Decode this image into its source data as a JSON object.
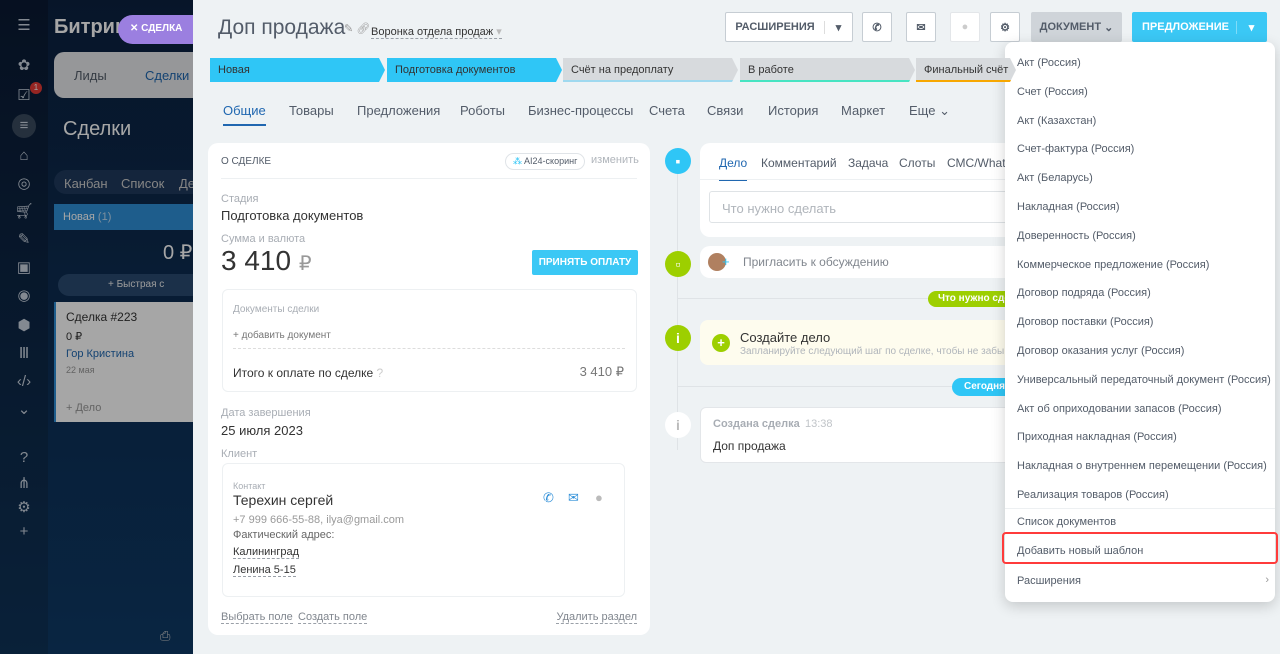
{
  "app": {
    "brand": "Битрикс",
    "slider_tag": "СДЕЛКА",
    "badge_count": "1"
  },
  "bg": {
    "tabs": [
      "Лиды",
      "Сделки"
    ],
    "title": "Сделки",
    "views": [
      "Канбан",
      "Список",
      "Де"
    ],
    "column": "Новая",
    "column_count": "(1)",
    "column_sum": "0 ₽",
    "quick": "+ Быстрая с",
    "deal": {
      "title": "Сделка #223",
      "sum": "0 ₽",
      "person": "Гор Кристина",
      "date": "22 мая",
      "add": "+ Дело"
    }
  },
  "header": {
    "title": "Доп продажа",
    "pipeline": "Воронка отдела продаж",
    "extensions": "РАСШИРЕНИЯ",
    "document": "ДОКУМЕНТ",
    "proposal": "ПРЕДЛОЖЕНИЕ"
  },
  "stages": [
    {
      "label": "Новая",
      "color": "#2fc6f6"
    },
    {
      "label": "Подготовка документов",
      "color": "#2fc6f6"
    },
    {
      "label": "Счёт на предоплату",
      "color": "#d7dadd"
    },
    {
      "label": "В работе",
      "color": "#d7dadd"
    },
    {
      "label": "Финальный счёт",
      "color": "#d7dadd"
    }
  ],
  "tabs": [
    "Общие",
    "Товары",
    "Предложения",
    "Роботы",
    "Бизнес-процессы",
    "Счета",
    "Связи",
    "История",
    "Маркет",
    "Еще"
  ],
  "deal": {
    "section": "О СДЕЛКЕ",
    "scoring": "AI24-скоринг",
    "edit": "изменить",
    "stage_label": "Стадия",
    "stage": "Подготовка документов",
    "sum_label": "Сумма и валюта",
    "sum": "3 410",
    "currency": "₽",
    "pay": "ПРИНЯТЬ ОПЛАТУ",
    "docs_label": "Документы сделки",
    "add_doc": "+ добавить документ",
    "total_label": "Итого к оплате по сделке",
    "total": "3 410 ₽",
    "close_label": "Дата завершения",
    "close": "25 июля 2023",
    "client_label": "Клиент",
    "contact_label": "Контакт",
    "contact": "Терехин сергей",
    "contact_info": "+7 999 666-55-88, ilya@gmail.com",
    "addr_label": "Фактический адрес:",
    "city": "Калининград",
    "street": "Ленина 5-15",
    "choose": "Выбрать поле",
    "create": "Создать поле",
    "delete": "Удалить раздел"
  },
  "timeline": {
    "tabs": [
      "Дело",
      "Комментарий",
      "Задача",
      "Слоты",
      "СМС/Whats"
    ],
    "placeholder": "Что нужно сделать",
    "invite": "Пригласить к обсуждению",
    "todo_badge": "Что нужно сде",
    "create_title": "Создайте дело",
    "create_hint": "Запланируйте следующий шаг по сделке, чтобы не забы",
    "today": "Сегодня",
    "created": "Создана сделка",
    "time": "13:38",
    "created_text": "Доп продажа"
  },
  "menu": {
    "items": [
      "Акт (Россия)",
      "Счет (Россия)",
      "Акт (Казахстан)",
      "Счет-фактура (Россия)",
      "Акт (Беларусь)",
      "Накладная (Россия)",
      "Доверенность (Россия)",
      "Коммерческое предложение (Россия)",
      "Договор подряда (Россия)",
      "Договор поставки (Россия)",
      "Договор оказания услуг (Россия)",
      "Универсальный передаточный документ (Россия)",
      "Акт об оприходовании запасов (Россия)",
      "Приходная накладная (Россия)",
      "Накладная о внутреннем перемещении (Россия)",
      "Реализация товаров (Россия)"
    ],
    "list": "Список документов",
    "add_template": "Добавить новый шаблон",
    "extensions": "Расширения",
    "highlight_color": "#ff3b3b"
  }
}
